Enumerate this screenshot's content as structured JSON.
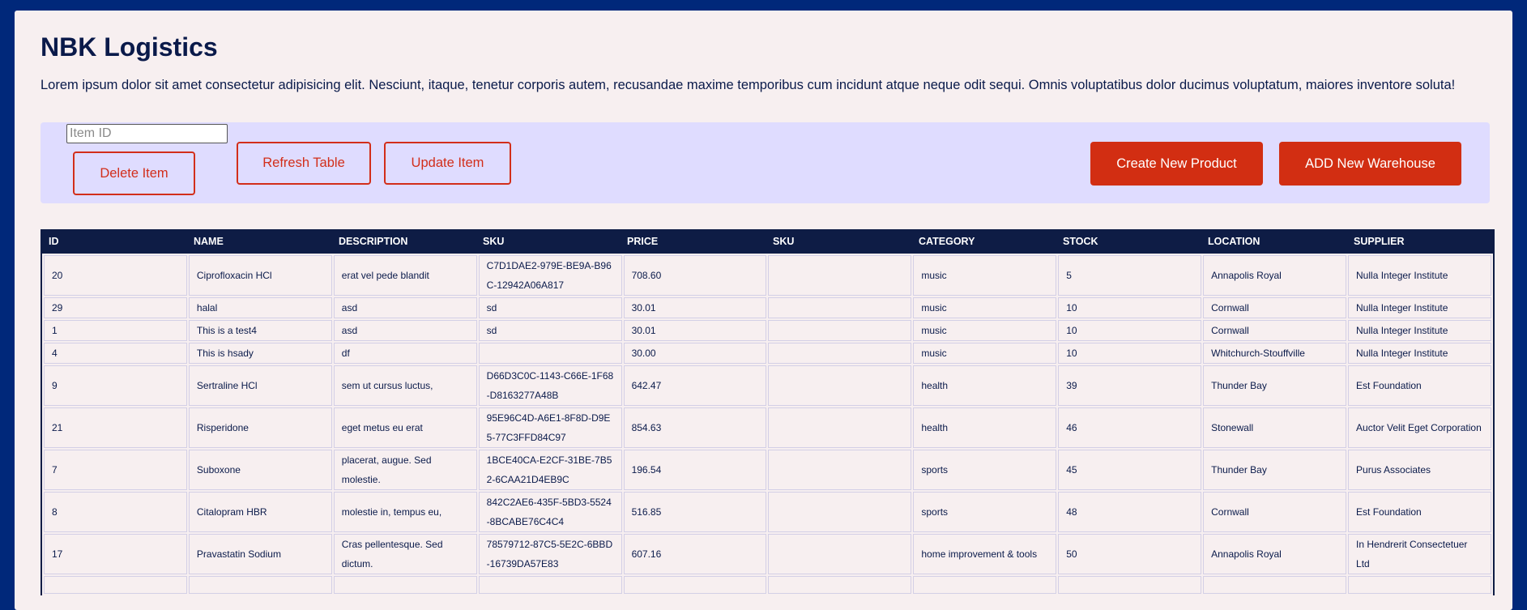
{
  "page": {
    "title": "NBK Logistics",
    "intro": "Lorem ipsum dolor sit amet consectetur adipisicing elit. Nesciunt, itaque, tenetur corporis autem, recusandae maxime temporibus cum incidunt atque neque odit sequi. Omnis voluptatibus dolor ducimus voluptatum, maiores inventore soluta!"
  },
  "toolbar": {
    "item_id_placeholder": "Item ID",
    "item_id_value": "",
    "delete_label": "Delete Item",
    "refresh_label": "Refresh Table",
    "update_label": "Update Item",
    "create_label": "Create New Product",
    "warehouse_label": "ADD New Warehouse"
  },
  "colors": {
    "background": "#00287a",
    "panel": "#f7eff0",
    "toolbar": "#dfdcff",
    "accent": "#d22e12",
    "table_header": "#0e1c45",
    "text": "#0a1a4a"
  },
  "table": {
    "headers": [
      "ID",
      "NAME",
      "DESCRIPTION",
      "SKU",
      "PRICE",
      "SKU",
      "CATEGORY",
      "STOCK",
      "LOCATION",
      "SUPPLIER"
    ],
    "rows": [
      [
        "20",
        "Ciprofloxacin HCl",
        "erat vel pede blandit",
        "C7D1DAE2-979E-BE9A-B96C-12942A06A817",
        "708.60",
        "",
        "music",
        "5",
        "Annapolis Royal",
        "Nulla Integer Institute"
      ],
      [
        "29",
        "halal",
        "asd",
        "sd",
        "30.01",
        "",
        "music",
        "10",
        "Cornwall",
        "Nulla Integer Institute"
      ],
      [
        "1",
        "This is a test4",
        "asd",
        "sd",
        "30.01",
        "",
        "music",
        "10",
        "Cornwall",
        "Nulla Integer Institute"
      ],
      [
        "4",
        "This is hsady",
        "df",
        "",
        "30.00",
        "",
        "music",
        "10",
        "Whitchurch-Stouffville",
        "Nulla Integer Institute"
      ],
      [
        "9",
        "Sertraline HCl",
        "sem ut cursus luctus,",
        "D66D3C0C-1143-C66E-1F68-D8163277A48B",
        "642.47",
        "",
        "health",
        "39",
        "Thunder Bay",
        "Est Foundation"
      ],
      [
        "21",
        "Risperidone",
        "eget metus eu erat",
        "95E96C4D-A6E1-8F8D-D9E5-77C3FFD84C97",
        "854.63",
        "",
        "health",
        "46",
        "Stonewall",
        "Auctor Velit Eget Corporation"
      ],
      [
        "7",
        "Suboxone",
        "placerat, augue. Sed molestie.",
        "1BCE40CA-E2CF-31BE-7B52-6CAA21D4EB9C",
        "196.54",
        "",
        "sports",
        "45",
        "Thunder Bay",
        "Purus Associates"
      ],
      [
        "8",
        "Citalopram HBR",
        "molestie in, tempus eu,",
        "842C2AE6-435F-5BD3-5524-8BCABE76C4C4",
        "516.85",
        "",
        "sports",
        "48",
        "Cornwall",
        "Est Foundation"
      ],
      [
        "17",
        "Pravastatin Sodium",
        "Cras pellentesque. Sed dictum.",
        "78579712-87C5-5E2C-6BBD-16739DA57E83",
        "607.16",
        "",
        "home improvement & tools",
        "50",
        "Annapolis Royal",
        "In Hendrerit Consectetuer Ltd"
      ],
      [
        "",
        "",
        "",
        "",
        "",
        "",
        "",
        "",
        "",
        ""
      ]
    ]
  }
}
